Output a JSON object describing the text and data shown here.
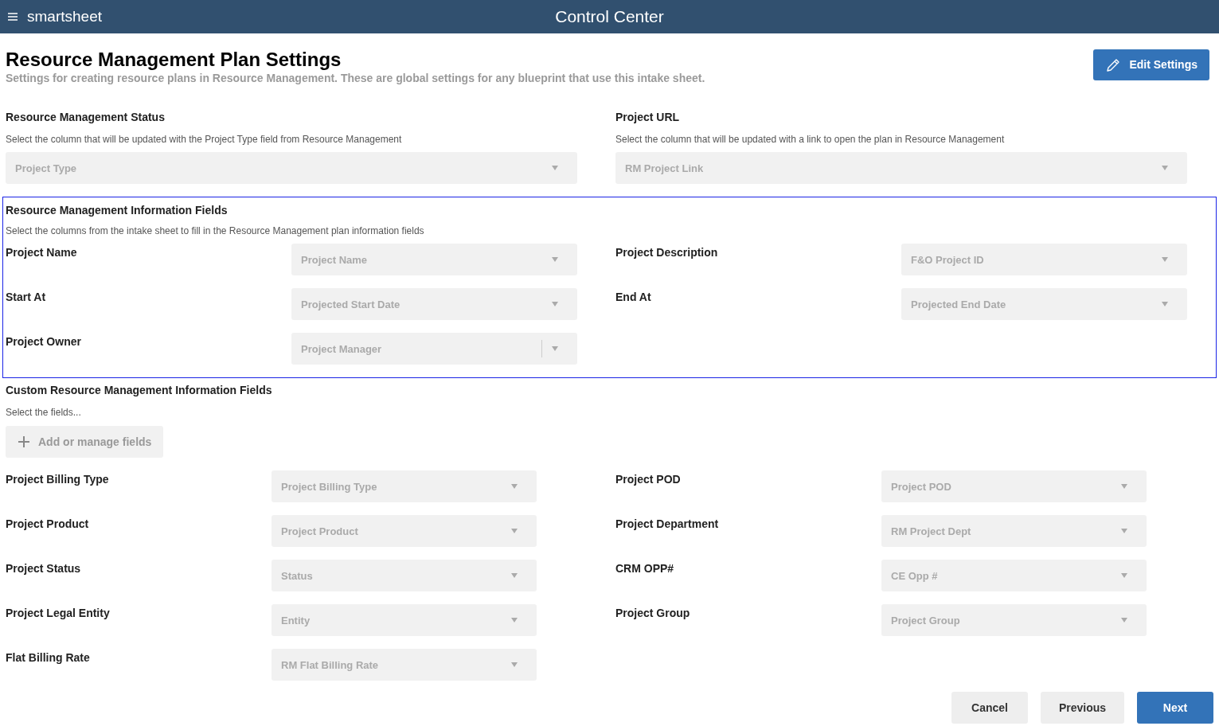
{
  "header": {
    "brand": "smartsheet",
    "title": "Control Center"
  },
  "page": {
    "title": "Resource Management Plan Settings",
    "subtitle": "Settings for creating resource plans in Resource Management. These are global settings for any blueprint that use this intake sheet.",
    "edit_button": "Edit Settings"
  },
  "top_fields": [
    {
      "title": "Resource Management Status",
      "description": "Select the column that will be updated with the Project Type field from Resource Management",
      "value": "Project Type"
    },
    {
      "title": "Project URL",
      "description": "Select the column that will be updated with a link to open the plan in Resource Management",
      "value": "RM Project Link"
    }
  ],
  "info_section": {
    "title": "Resource Management Information Fields",
    "description": "Select the columns from the intake sheet to fill in the Resource Management plan information fields",
    "highlighted": true,
    "fields": [
      {
        "label": "Project Name",
        "value": "Project Name",
        "separator": false
      },
      {
        "label": "Project Description",
        "value": "F&O Project ID",
        "separator": false
      },
      {
        "label": "Start At",
        "value": "Projected Start Date",
        "separator": false
      },
      {
        "label": "End At",
        "value": "Projected End Date",
        "separator": false
      },
      {
        "label": "Project Owner",
        "value": "Project Manager",
        "separator": true
      }
    ]
  },
  "custom_section": {
    "title": "Custom Resource Management Information Fields",
    "description": "Select the fields...",
    "add_button": "Add or manage fields",
    "fields": [
      {
        "label": "Project Billing Type",
        "value": "Project Billing Type"
      },
      {
        "label": "Project POD",
        "value": "Project POD"
      },
      {
        "label": "Project Product",
        "value": "Project Product"
      },
      {
        "label": "Project Department",
        "value": "RM Project Dept"
      },
      {
        "label": "Project Status",
        "value": "Status"
      },
      {
        "label": "CRM OPP#",
        "value": "CE Opp #"
      },
      {
        "label": "Project Legal Entity",
        "value": "Entity"
      },
      {
        "label": "Project Group",
        "value": "Project Group"
      },
      {
        "label": "Flat Billing Rate",
        "value": "RM Flat Billing Rate"
      }
    ]
  },
  "footer_buttons": [
    {
      "label": "Cancel",
      "kind": "secondary"
    },
    {
      "label": "Previous",
      "kind": "secondary"
    },
    {
      "label": "Next",
      "kind": "primary"
    }
  ]
}
